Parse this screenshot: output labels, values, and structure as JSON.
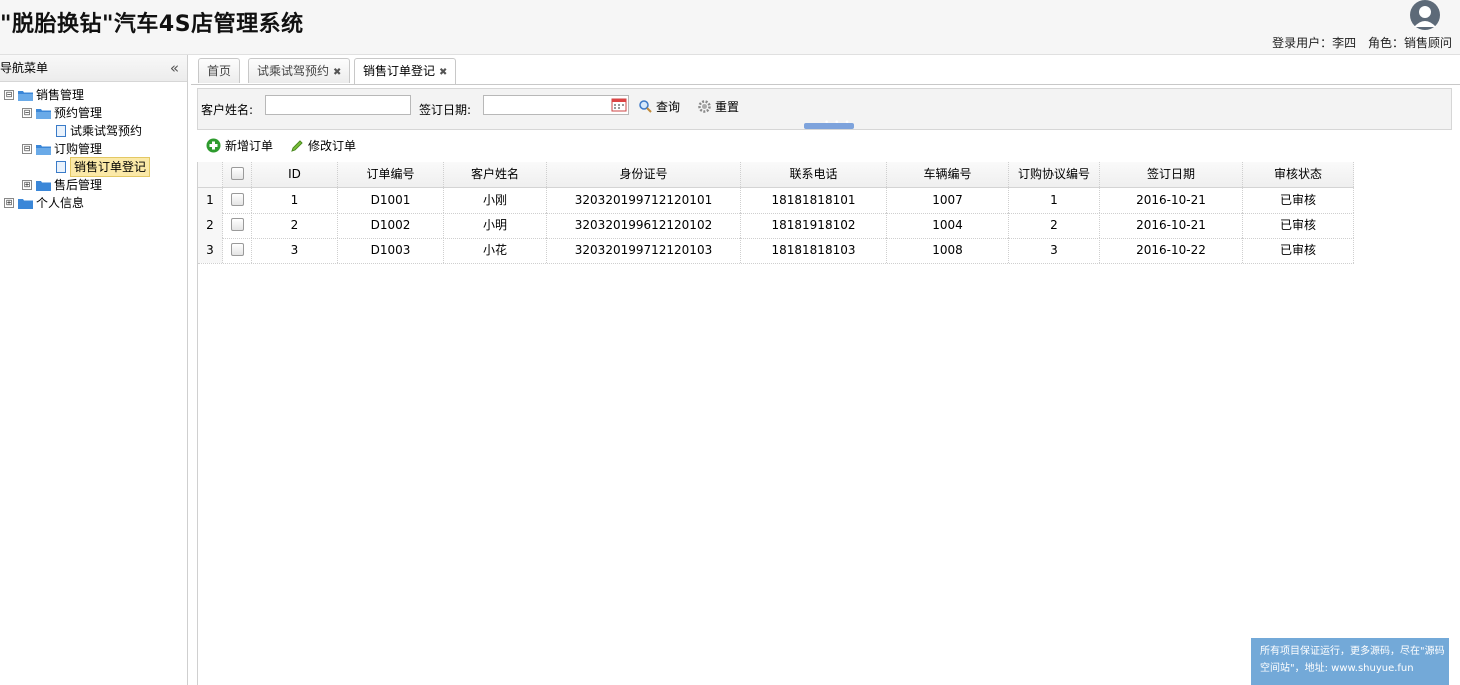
{
  "app": {
    "title": "\"脱胎换钻\"汽车4S店管理系统",
    "login_user": "登录用户：李四",
    "role": "角色：销售顾问"
  },
  "nav": {
    "title": "导航菜单",
    "tree": [
      {
        "label": "销售管理",
        "expander": "⊟",
        "type": "folder"
      },
      {
        "label": "预约管理",
        "expander": "⊟",
        "type": "folder"
      },
      {
        "label": "试乘试驾预约",
        "type": "file"
      },
      {
        "label": "订购管理",
        "expander": "⊟",
        "type": "folder"
      },
      {
        "label": "销售订单登记",
        "type": "file",
        "selected": true
      },
      {
        "label": "售后管理",
        "expander": "⊞",
        "type": "folder"
      },
      {
        "label": "个人信息",
        "expander": "⊞",
        "type": "folder"
      }
    ]
  },
  "tabs": [
    {
      "label": "首页",
      "closable": false
    },
    {
      "label": "试乘试驾预约",
      "closable": true
    },
    {
      "label": "销售订单登记",
      "closable": true,
      "active": true
    }
  ],
  "search": {
    "customer_label": "客户姓名:",
    "customer_value": "",
    "date_label": "签订日期:",
    "date_value": "",
    "query_label": "查询",
    "reset_label": "重置"
  },
  "toolbar": {
    "add_label": "新增订单",
    "edit_label": "修改订单"
  },
  "grid": {
    "columns": [
      "ID",
      "订单编号",
      "客户姓名",
      "身份证号",
      "联系电话",
      "车辆编号",
      "订购协议编号",
      "签订日期",
      "审核状态"
    ],
    "rows": [
      {
        "num": "1",
        "id": "1",
        "order_no": "D1001",
        "name": "小刚",
        "id_card": "320320199712120101",
        "phone": "18181818101",
        "car_no": "1007",
        "agreement": "1",
        "date": "2016-10-21",
        "status": "已审核"
      },
      {
        "num": "2",
        "id": "2",
        "order_no": "D1002",
        "name": "小明",
        "id_card": "320320199612120102",
        "phone": "18181918102",
        "car_no": "1004",
        "agreement": "2",
        "date": "2016-10-21",
        "status": "已审核"
      },
      {
        "num": "3",
        "id": "3",
        "order_no": "D1003",
        "name": "小花",
        "id_card": "320320199712120103",
        "phone": "18181818103",
        "car_no": "1008",
        "agreement": "3",
        "date": "2016-10-22",
        "status": "已审核"
      }
    ]
  },
  "ad": {
    "line1": "所有项目保证运行，更多源码，尽在\"源码",
    "line2": "空间站\"，地址: www.shuyue.fun"
  },
  "colors": {
    "selected_node_bg": "#fbe9a8",
    "folder_blue": "#3b87d8",
    "ad_bg": "#73a9d8",
    "split_handle": "#7ea3dc"
  }
}
